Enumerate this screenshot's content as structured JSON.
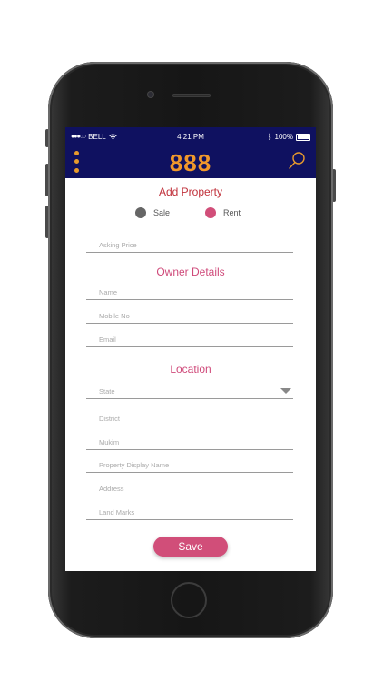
{
  "status_bar": {
    "carrier": "BELL",
    "time": "4:21 PM",
    "battery": "100%"
  },
  "app_bar": {
    "logo": "888",
    "menu_icon": "more-vert-icon",
    "search_icon": "search-icon",
    "color": "#0f1160",
    "accent": "#f0982b"
  },
  "form": {
    "title": "Add Property",
    "listing_type": {
      "options": [
        {
          "label": "Sale",
          "selected": false,
          "color": "#666666"
        },
        {
          "label": "Rent",
          "selected": true,
          "color": "#d14e79"
        }
      ]
    },
    "asking_price_placeholder": "Asking Price",
    "owner_section_title": "Owner Details",
    "owner_fields": {
      "name": "Name",
      "mobile": "Mobile No",
      "email": "Email"
    },
    "location_section_title": "Location",
    "location_fields": {
      "state": "State",
      "district": "District",
      "mukim": "Mukim",
      "display_name": "Property Display Name",
      "address": "Address",
      "landmarks": "Land Marks"
    },
    "save_label": "Save",
    "save_color": "#d14e79"
  }
}
